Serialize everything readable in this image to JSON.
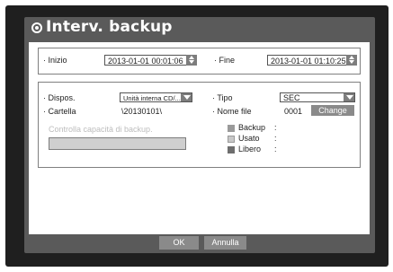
{
  "dialog": {
    "title": "Interv. backup"
  },
  "period": {
    "start_label": "· Inizio",
    "start_value": "2013-01-01 00:01:06",
    "end_label": "· Fine",
    "end_value": "2013-01-01 01:10:25"
  },
  "settings": {
    "device_label": "· Dispos.",
    "device_value": "Unità interna CD/...",
    "type_label": "· Tipo",
    "type_value": "SEC",
    "folder_label": "· Cartella",
    "folder_value": "\\20130101\\",
    "filename_label": "· Nome file",
    "filename_value": "0001",
    "change_label": "Change",
    "check_capacity_label": "Controlla capacità di backup."
  },
  "capacity": {
    "items": [
      {
        "label": "Backup",
        "sep": ":",
        "value": "",
        "color": "#9a9a9a"
      },
      {
        "label": "Usato",
        "sep": ":",
        "value": "",
        "color": "#c8c8c8"
      },
      {
        "label": "Libero",
        "sep": ":",
        "value": "",
        "color": "#6e6e6e"
      }
    ],
    "fill_fraction": 0
  },
  "footer": {
    "ok_label": "OK",
    "cancel_label": "Annulla"
  }
}
